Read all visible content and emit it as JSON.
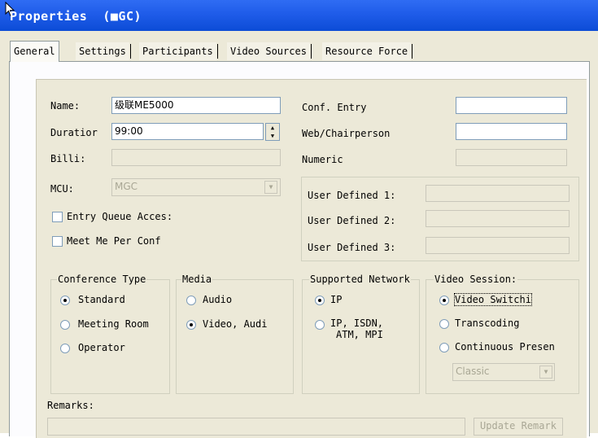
{
  "window": {
    "title": "Properties  (■GC)"
  },
  "tabs": [
    {
      "label": "General",
      "active": true
    },
    {
      "label": "Settings",
      "active": false
    },
    {
      "label": "Participants",
      "active": false
    },
    {
      "label": "Video Sources",
      "active": false
    },
    {
      "label": "Resource Force",
      "active": false
    }
  ],
  "general": {
    "name_label": "Name:",
    "name_value": "级联ME5000",
    "duration_label": "Duratior",
    "duration_value": "99:00",
    "billing_label": "Billi:",
    "billing_value": "",
    "mcu_label": "MCU:",
    "mcu_value": "MGC",
    "entry_queue_label": "Entry Queue Acces:",
    "entry_queue_checked": false,
    "meet_me_label": "Meet Me Per Conf",
    "meet_me_checked": false,
    "conf_entry_label": "Conf. Entry",
    "conf_entry_value": "",
    "web_chair_label": "Web/Chairperson",
    "web_chair_value": "",
    "numeric_label": "Numeric",
    "numeric_value": "",
    "user_defined": [
      {
        "label": "User Defined 1:",
        "value": ""
      },
      {
        "label": "User Defined 2:",
        "value": ""
      },
      {
        "label": "User Defined 3:",
        "value": ""
      }
    ]
  },
  "conference_type": {
    "title": "Conference Type",
    "options": [
      "Standard",
      "Meeting Room",
      "Operator"
    ],
    "selected": "Standard"
  },
  "media": {
    "title": "Media",
    "options": [
      "Audio",
      "Video, Audi"
    ],
    "selected": "Video, Audi"
  },
  "supported_network": {
    "title": "Supported Network",
    "options": [
      "IP",
      "IP, ISDN,",
      "ATM, MPI"
    ],
    "selected": "IP"
  },
  "video_session": {
    "title": "Video Session:",
    "options": [
      "Video Switchi",
      "Transcoding",
      "Continuous Presen"
    ],
    "selected": "Video Switchi",
    "layout_value": "Classic"
  },
  "remarks": {
    "label": "Remarks:",
    "value": "",
    "update_button": "Update Remark"
  },
  "colors": {
    "titlebar": "#0c4cd6",
    "dialog_bg": "#ece9d8",
    "field_border": "#7f9db9"
  }
}
